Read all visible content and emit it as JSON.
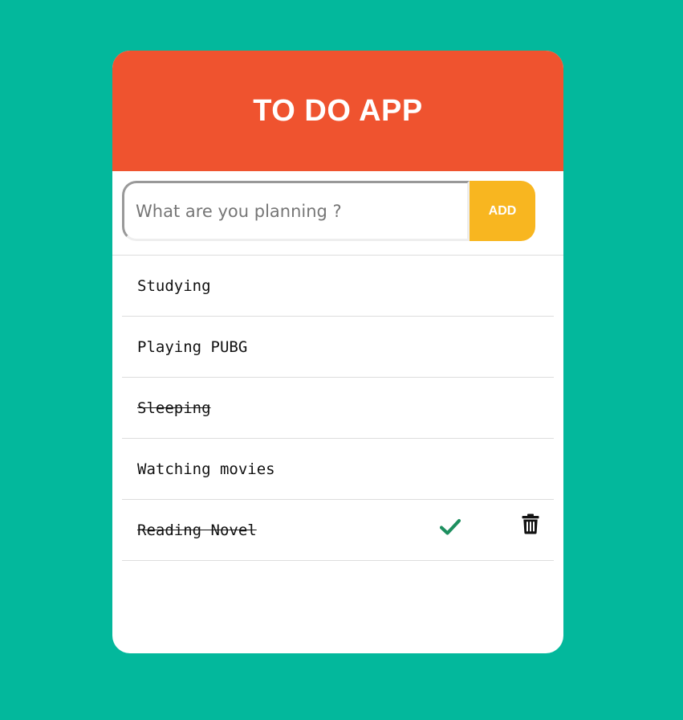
{
  "app": {
    "title": "TO DO APP"
  },
  "input": {
    "value": "",
    "placeholder": "What are you planning ?"
  },
  "add_button": {
    "label": "ADD"
  },
  "todos": [
    {
      "text": "Studying",
      "completed": false
    },
    {
      "text": "Playing PUBG",
      "completed": false
    },
    {
      "text": "Sleeping",
      "completed": true
    },
    {
      "text": "Watching movies",
      "completed": false
    },
    {
      "text": "Reading Novel",
      "completed": true,
      "actions_visible": true
    }
  ],
  "icons": {
    "complete": "check-icon",
    "delete": "trash-icon"
  },
  "colors": {
    "background": "#03b89c",
    "header": "#ef532f",
    "add_button": "#f8b620",
    "check": "#1d8f5f",
    "card": "#ffffff"
  }
}
